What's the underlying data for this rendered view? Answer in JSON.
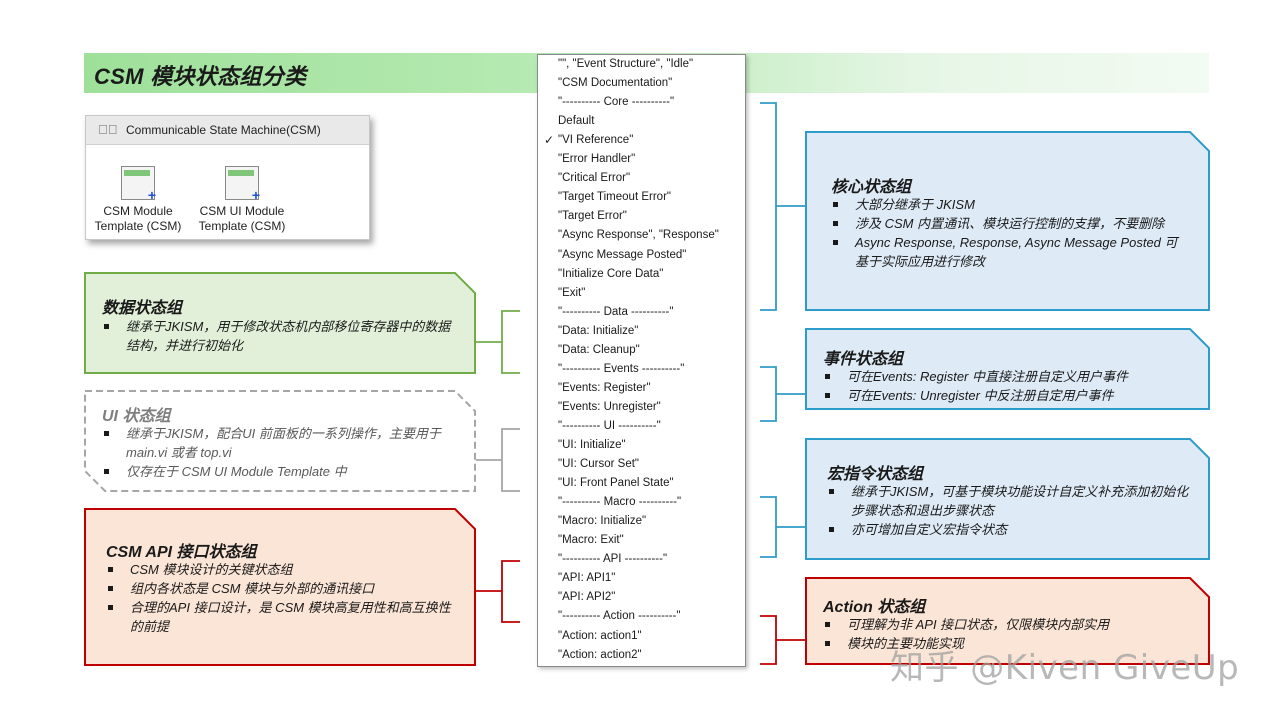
{
  "title": "CSM 模块状态组分类",
  "palette": {
    "title": "Communicable State Machine(CSM)",
    "pin_icon": "pin-icon",
    "items": [
      {
        "label_line1": "CSM Module",
        "label_line2": "Template (CSM)",
        "icon": "csm-module-vi-icon"
      },
      {
        "label_line1": "CSM UI Module",
        "label_line2": "Template (CSM)",
        "icon": "csm-ui-module-vi-icon"
      }
    ]
  },
  "menu": {
    "checked_item": "\"VI Reference\"",
    "items": [
      "\"\", \"Event Structure\", \"Idle\"",
      "\"CSM Documentation\"",
      "\"---------- Core ----------\"",
      "Default",
      "\"VI Reference\"",
      "\"Error Handler\"",
      "\"Critical Error\"",
      "\"Target Timeout Error\"",
      "\"Target Error\"",
      "\"Async Response\", \"Response\"",
      "\"Async Message Posted\"",
      "\"Initialize Core Data\"",
      "\"Exit\"",
      "\"---------- Data ----------\"",
      "\"Data: Initialize\"",
      "\"Data: Cleanup\"",
      "\"---------- Events ----------\"",
      "\"Events: Register\"",
      "\"Events: Unregister\"",
      "\"---------- UI ----------\"",
      "\"UI: Initialize\"",
      "\"UI: Cursor Set\"",
      "\"UI: Front Panel State\"",
      "\"---------- Macro ----------\"",
      "\"Macro: Initialize\"",
      "\"Macro: Exit\"",
      "\"---------- API ----------\"",
      "\"API: API1\"",
      "\"API: API2\"",
      "\"---------- Action ----------\"",
      "\"Action: action1\"",
      "\"Action: action2\""
    ]
  },
  "groups": {
    "data": {
      "title": "数据状态组",
      "bullets": [
        "继承于JKISM，用于修改状态机内部移位寄存器中的数据结构，并进行初始化"
      ],
      "fill": "#e2f0d9",
      "stroke": "#70ad47"
    },
    "ui": {
      "title": "UI 状态组",
      "bullets": [
        "继承于JKISM，配合UI 前面板的一系列操作，主要用于main.vi 或者 top.vi",
        "仅存在于 CSM UI Module Template 中"
      ],
      "fill": "#ffffff",
      "stroke": "#a6a6a6"
    },
    "api": {
      "title": "CSM API 接口状态组",
      "bullets": [
        "CSM 模块设计的关键状态组",
        "组内各状态是 CSM 模块与外部的通讯接口",
        "合理的API 接口设计，是 CSM 模块高复用性和高互换性的前提"
      ],
      "fill": "#fbe5d6",
      "stroke": "#c00000"
    },
    "core": {
      "title": "核心状态组",
      "bullets": [
        "大部分继承于 JKISM",
        "涉及 CSM 内置通讯、模块运行控制的支撑，不要删除",
        "Async Response, Response, Async Message Posted 可基于实际应用进行修改"
      ],
      "fill": "#deebf7",
      "stroke": "#2e9cca"
    },
    "events": {
      "title": "事件状态组",
      "bullets": [
        "可在Events: Register 中直接注册自定义用户事件",
        "可在Events: Unregister 中反注册自定用户事件"
      ],
      "fill": "#deebf7",
      "stroke": "#2e9cca"
    },
    "macro": {
      "title": "宏指令状态组",
      "bullets": [
        "继承于JKISM，可基于模块功能设计自定义补充添加初始化步骤状态和退出步骤状态",
        "亦可增加自定义宏指令状态"
      ],
      "fill": "#deebf7",
      "stroke": "#2e9cca"
    },
    "action": {
      "title": "Action 状态组",
      "bullets": [
        "可理解为非 API 接口状态，仅限模块内部实用",
        "模块的主要功能实现"
      ],
      "fill": "#fbe5d6",
      "stroke": "#c00000"
    }
  },
  "watermark": "知乎 @Kiven GiveUp"
}
